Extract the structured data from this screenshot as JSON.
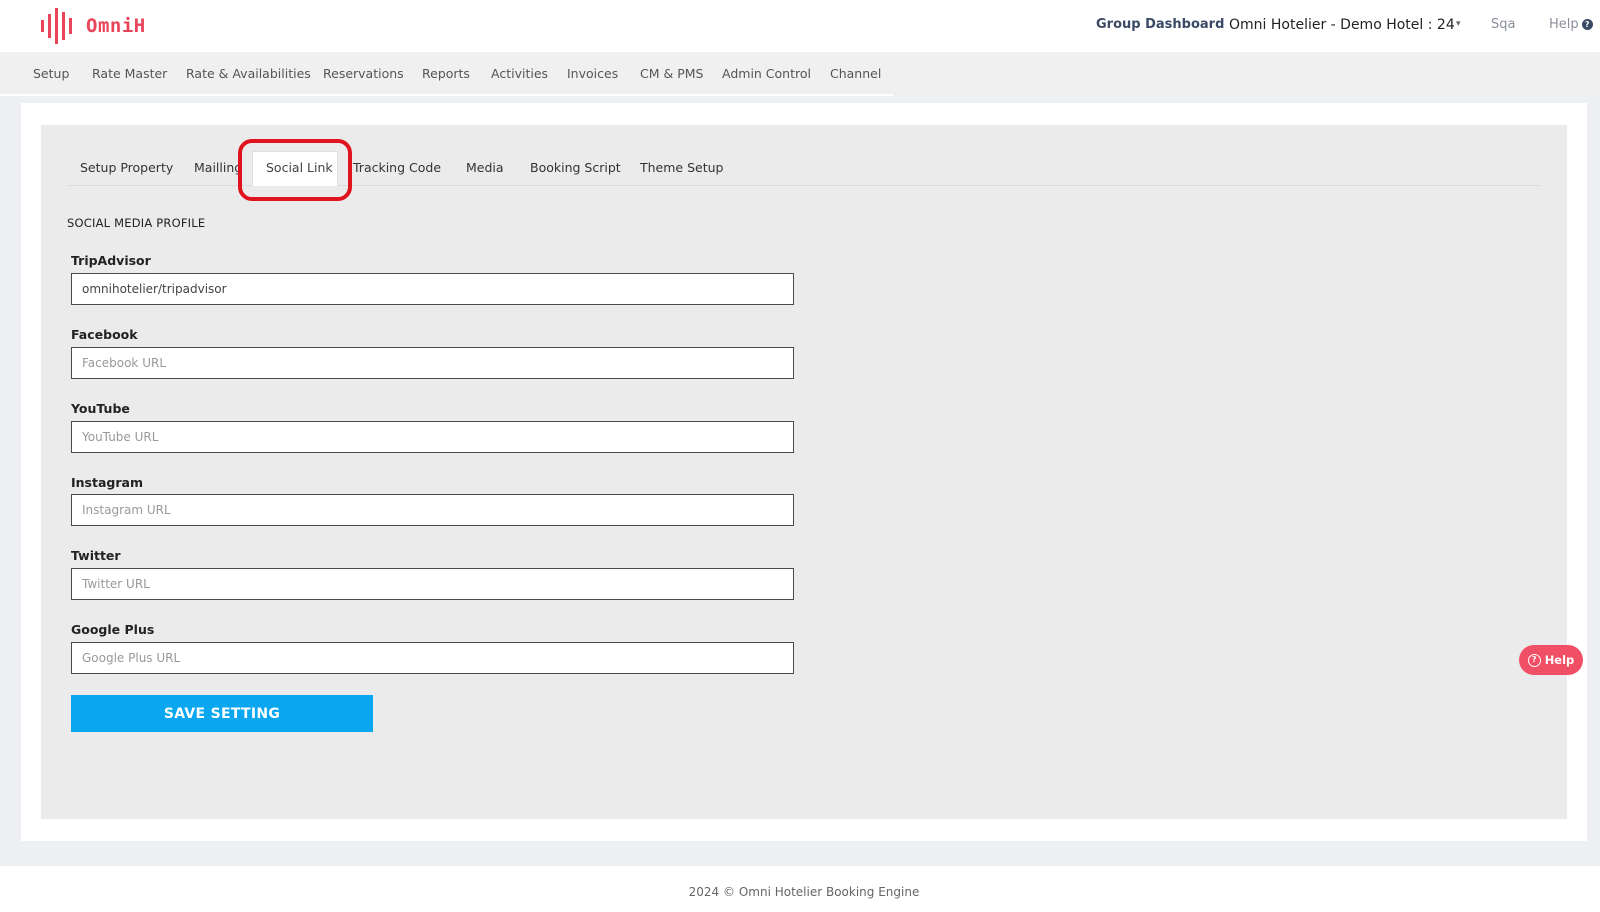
{
  "brand": {
    "name": "OmniH",
    "accent_color": "#e8455a"
  },
  "header": {
    "group_dashboard": "Group Dashboard",
    "hotel": "Omni Hotelier - Demo Hotel : 24",
    "caret": "▾",
    "user": "Sqa",
    "help": "Help",
    "help_icon": "?"
  },
  "nav": {
    "items": [
      "Setup",
      "Rate Master",
      "Rate & Availabilities",
      "Reservations",
      "Reports",
      "Activities",
      "Invoices",
      "CM & PMS",
      "Admin Control",
      "Channel"
    ]
  },
  "tabs": {
    "items": [
      "Setup Property",
      "Mailling",
      "Social Link",
      "Tracking Code",
      "Media",
      "Booking Script",
      "Theme Setup"
    ],
    "active": "Social Link"
  },
  "form": {
    "section_title": "SOCIAL MEDIA PROFILE",
    "fields": [
      {
        "label": "TripAdvisor",
        "value": "omnihotelier/tripadvisor",
        "placeholder": ""
      },
      {
        "label": "Facebook",
        "value": "",
        "placeholder": "Facebook URL"
      },
      {
        "label": "YouTube",
        "value": "",
        "placeholder": "YouTube URL"
      },
      {
        "label": "Instagram",
        "value": "",
        "placeholder": "Instagram URL"
      },
      {
        "label": "Twitter",
        "value": "",
        "placeholder": "Twitter URL"
      },
      {
        "label": "Google Plus",
        "value": "",
        "placeholder": "Google Plus URL"
      }
    ],
    "save_label": "SAVE SETTING",
    "save_color": "#0aa6ef"
  },
  "help_widget": {
    "label": "Help",
    "icon": "?",
    "color": "#f04f65"
  },
  "highlight_color": "#e0141e",
  "footer": {
    "text": "2024 © Omni Hotelier Booking Engine"
  }
}
